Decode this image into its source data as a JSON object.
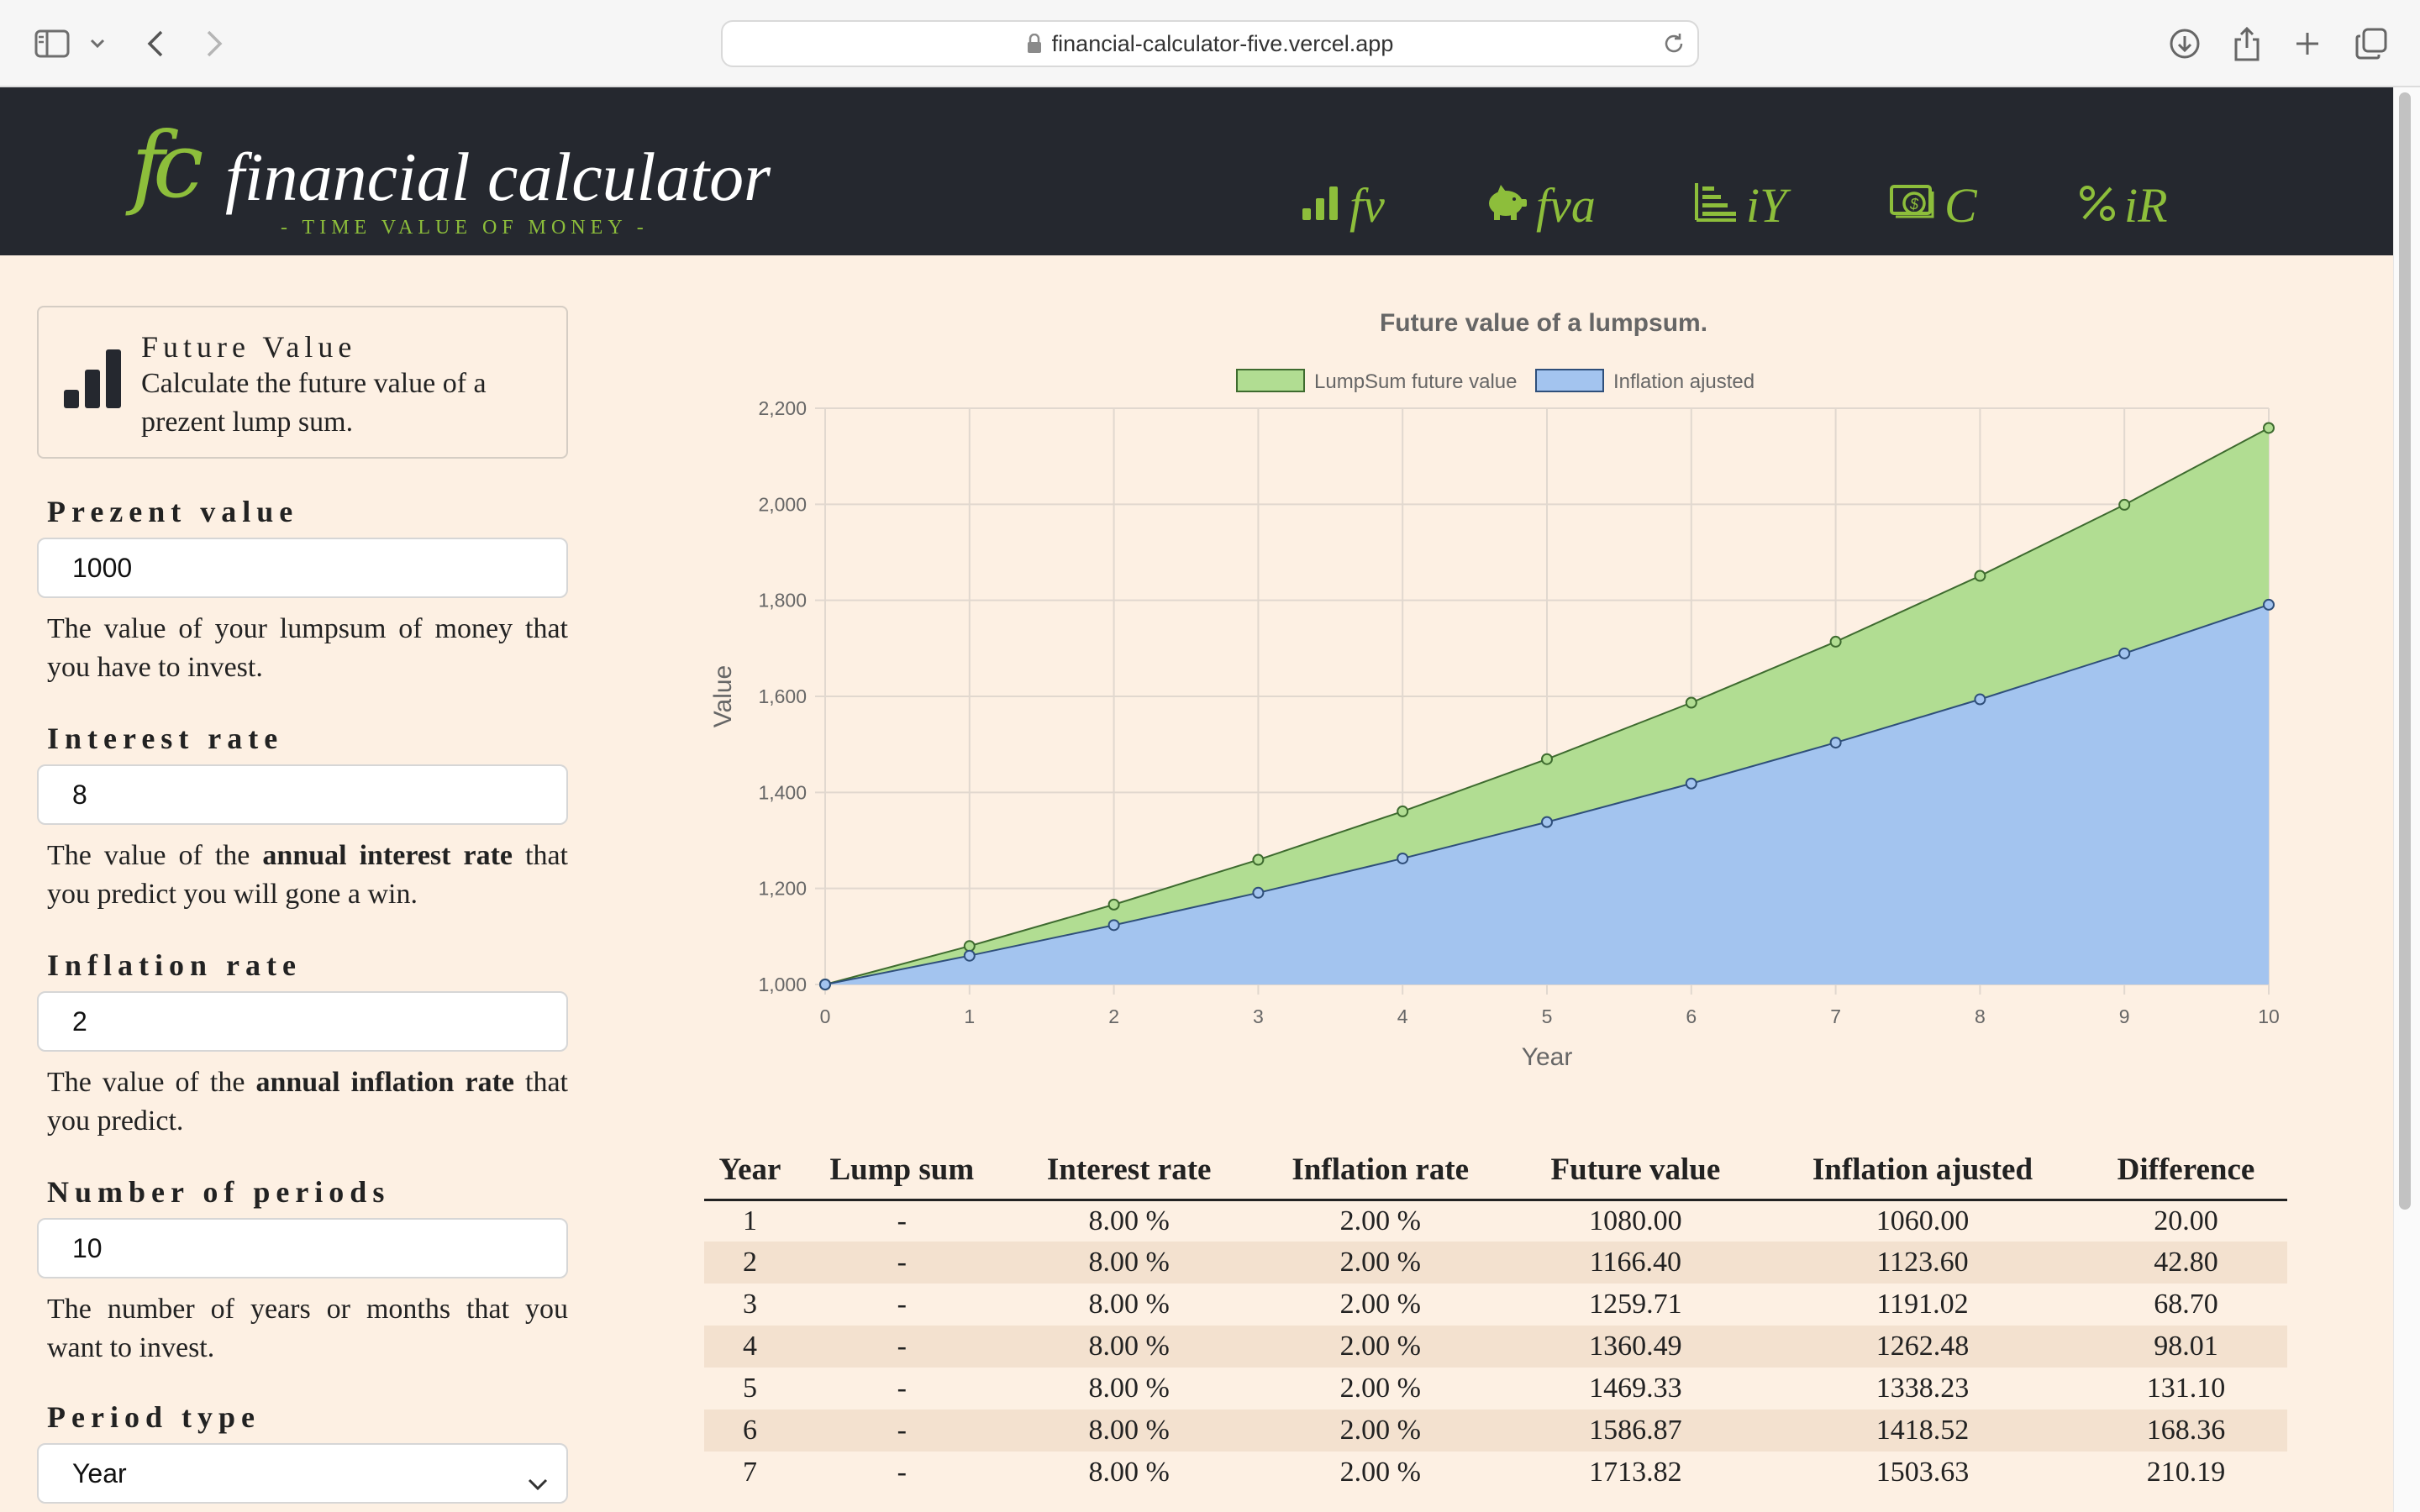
{
  "browser": {
    "url": "financial-calculator-five.vercel.app"
  },
  "header": {
    "logo_mark": "fc",
    "title": "financial calculator",
    "subtitle": "- TIME VALUE OF MONEY -",
    "nav": [
      {
        "label": "fv",
        "icon": "bar-chart-icon"
      },
      {
        "label": "fva",
        "icon": "piggy-bank-icon"
      },
      {
        "label": "iY",
        "icon": "list-bars-icon"
      },
      {
        "label": "C",
        "icon": "money-bill-icon"
      },
      {
        "label": "iR",
        "icon": "percent-icon"
      }
    ]
  },
  "sidebar": {
    "card": {
      "title": "Future Value",
      "description": "Calculate the future value of a prezent lump sum."
    },
    "fields": {
      "present_value": {
        "label": "Prezent value",
        "value": "1000",
        "help": "The value of your lumpsum of money that you have to invest."
      },
      "interest_rate": {
        "label": "Interest rate",
        "value": "8",
        "help_pre": "The value of the ",
        "help_bold": "annual interest rate",
        "help_post": " that you predict you will gone a win."
      },
      "inflation_rate": {
        "label": "Inflation rate",
        "value": "2",
        "help_pre": "The value of the ",
        "help_bold": "annual inflation rate",
        "help_post": " that you predict."
      },
      "periods": {
        "label": "Number of periods",
        "value": "10",
        "help": "The number of years or months that you want to invest."
      },
      "period_type": {
        "label": "Period type",
        "value": "Year"
      }
    }
  },
  "chart_data": {
    "type": "area",
    "title": "Future value of a lumpsum.",
    "xlabel": "Year",
    "ylabel": "Value",
    "x": [
      0,
      1,
      2,
      3,
      4,
      5,
      6,
      7,
      8,
      9,
      10
    ],
    "xlim": [
      0,
      10
    ],
    "ylim": [
      1000,
      2200
    ],
    "yticks": [
      1000,
      1200,
      1400,
      1600,
      1800,
      2000,
      2200
    ],
    "ytick_labels": [
      "1,000",
      "1,200",
      "1,400",
      "1,600",
      "1,800",
      "2,000",
      "2,200"
    ],
    "grid": true,
    "legend_position": "top",
    "series": [
      {
        "name": "LumpSum future value",
        "values": [
          1000,
          1080,
          1166.4,
          1259.71,
          1360.49,
          1469.33,
          1586.87,
          1713.82,
          1850.93,
          1999.0,
          2158.92
        ],
        "fill": "#b1dd92",
        "stroke": "#3e6b2f"
      },
      {
        "name": "Inflation ajusted",
        "values": [
          1000,
          1060,
          1123.6,
          1191.02,
          1262.48,
          1338.23,
          1418.52,
          1503.63,
          1593.85,
          1689.48,
          1790.85
        ],
        "fill": "#a3c4ef",
        "stroke": "#2f4f7a"
      }
    ]
  },
  "table": {
    "headers": [
      "Year",
      "Lump sum",
      "Interest rate",
      "Inflation rate",
      "Future value",
      "Inflation ajusted",
      "Difference"
    ],
    "rows": [
      [
        "1",
        "-",
        "8.00 %",
        "2.00 %",
        "1080.00",
        "1060.00",
        "20.00"
      ],
      [
        "2",
        "-",
        "8.00 %",
        "2.00 %",
        "1166.40",
        "1123.60",
        "42.80"
      ],
      [
        "3",
        "-",
        "8.00 %",
        "2.00 %",
        "1259.71",
        "1191.02",
        "68.70"
      ],
      [
        "4",
        "-",
        "8.00 %",
        "2.00 %",
        "1360.49",
        "1262.48",
        "98.01"
      ],
      [
        "5",
        "-",
        "8.00 %",
        "2.00 %",
        "1469.33",
        "1338.23",
        "131.10"
      ],
      [
        "6",
        "-",
        "8.00 %",
        "2.00 %",
        "1586.87",
        "1418.52",
        "168.36"
      ],
      [
        "7",
        "-",
        "8.00 %",
        "2.00 %",
        "1713.82",
        "1503.63",
        "210.19"
      ]
    ]
  }
}
